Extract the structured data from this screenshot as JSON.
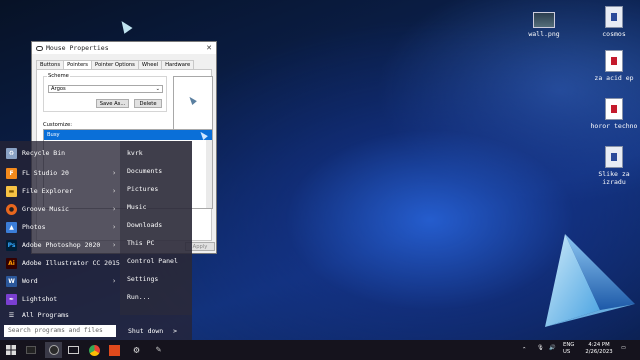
{
  "desktop": {
    "icons": [
      {
        "label": "wall.png"
      },
      {
        "label": "cosmos"
      },
      {
        "label": "za acid ep"
      },
      {
        "label": "horor techno"
      },
      {
        "label": "Slike za izradu"
      }
    ]
  },
  "dialog": {
    "title": "Mouse Properties",
    "tabs": [
      "Buttons",
      "Pointers",
      "Pointer Options",
      "Wheel",
      "Hardware"
    ],
    "scheme_label": "Scheme",
    "scheme_value": "Argos",
    "save_as": "Save As...",
    "delete": "Delete",
    "customize_label": "Customize:",
    "selected_item": "Busy",
    "apply": "Apply"
  },
  "start_menu": {
    "apps": [
      {
        "label": "Recycle Bin",
        "icon": "recycle-bin-icon",
        "arrow": false
      },
      {
        "label": "FL Studio 20",
        "icon": "fl-studio-icon",
        "arrow": true
      },
      {
        "label": "File Explorer",
        "icon": "file-explorer-icon",
        "arrow": true
      },
      {
        "label": "Groove Music",
        "icon": "groove-music-icon",
        "arrow": true
      },
      {
        "label": "Photos",
        "icon": "photos-icon",
        "arrow": true
      },
      {
        "label": "Adobe Photoshop 2020",
        "icon": "photoshop-icon",
        "arrow": true
      },
      {
        "label": "Adobe Illustrator CC 2015",
        "icon": "illustrator-icon",
        "arrow": false
      },
      {
        "label": "Word",
        "icon": "word-icon",
        "arrow": true
      },
      {
        "label": "Lightshot",
        "icon": "lightshot-icon",
        "arrow": false
      },
      {
        "label": "All Programs",
        "icon": "all-programs-icon",
        "arrow": false
      }
    ],
    "places": [
      "kvrk",
      "Documents",
      "Pictures",
      "Music",
      "Downloads",
      "This PC",
      "Control Panel",
      "Settings",
      "Run..."
    ],
    "search_placeholder": "Search programs and files",
    "shutdown": "Shut down",
    "shutdown_arrow": ">"
  },
  "tray": {
    "language": "ENG",
    "region": "US",
    "time": "4:24 PM",
    "date": "2/26/2023"
  },
  "colors": {
    "accent": "#0a6fd8",
    "photoshop": "#31a8ff",
    "illustrator": "#ff9a00",
    "word": "#2b579a"
  }
}
